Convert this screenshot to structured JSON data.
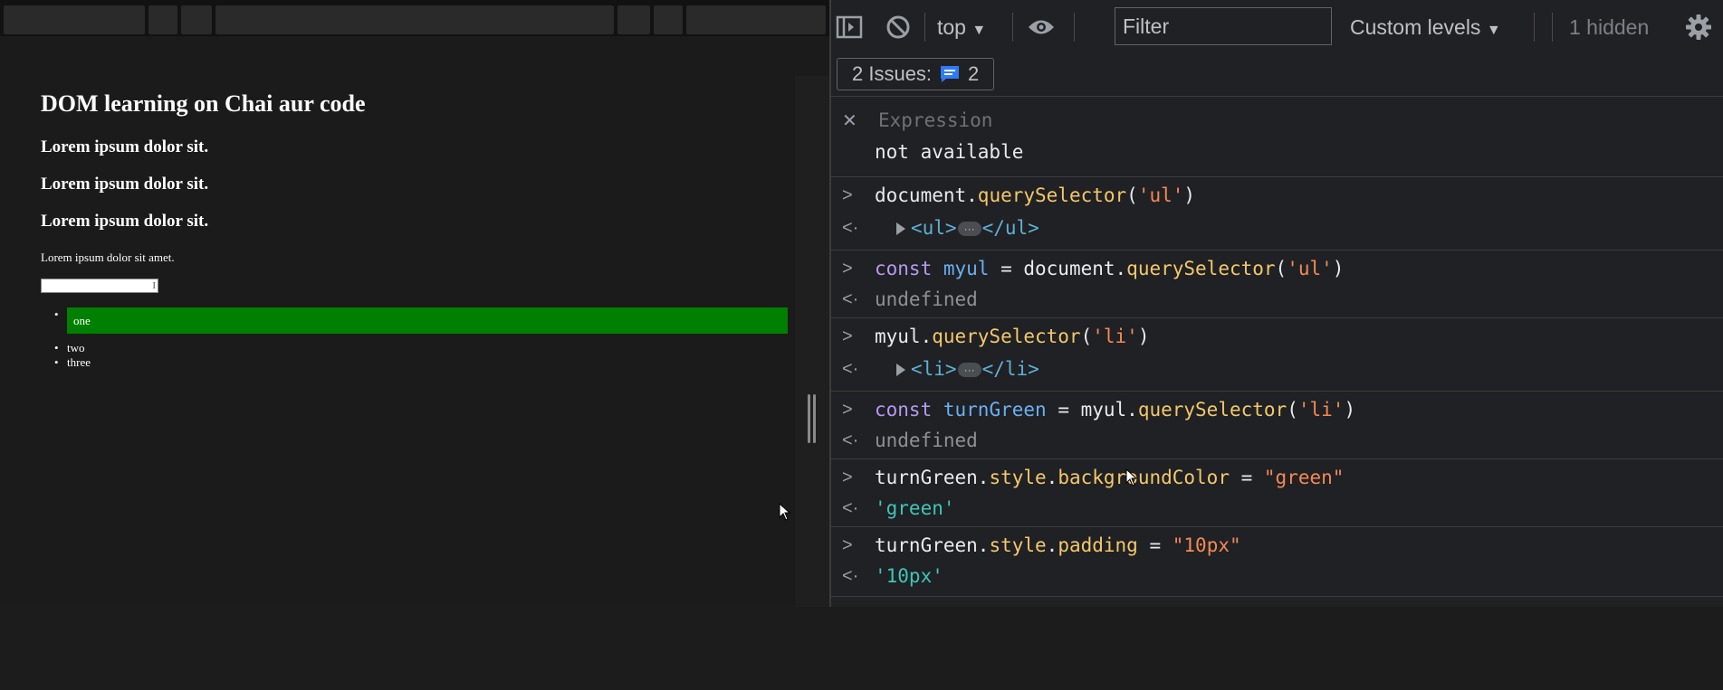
{
  "page": {
    "heading": "DOM learning on Chai aur code",
    "subheadings": [
      "Lorem ipsum dolor sit.",
      "Lorem ipsum dolor sit.",
      "Lorem ipsum dolor sit."
    ],
    "paragraph": "Lorem ipsum dolor sit amet.",
    "list_items": [
      "one",
      "two",
      "three"
    ],
    "highlight_color": "#008000"
  },
  "devtools": {
    "toolbar": {
      "context": "top",
      "filter_placeholder": "Filter",
      "levels": "Custom levels",
      "hidden": "1 hidden"
    },
    "issues": {
      "label": "2 Issues:",
      "count": "2"
    },
    "expression": {
      "label": "Expression",
      "value": "not available"
    },
    "console": [
      {
        "input": "document.querySelector('ul')",
        "output": "<ul> … </ul>"
      },
      {
        "input": "const myul = document.querySelector('ul')",
        "output": "undefined"
      },
      {
        "input": "myul.querySelector('li')",
        "output": "<li> … </li>"
      },
      {
        "input": "const turnGreen = myul.querySelector('li')",
        "output": "undefined"
      },
      {
        "input": "turnGreen.style.backgroundColor = \"green\"",
        "output": "'green'"
      },
      {
        "input": "turnGreen.style.padding = \"10px\"",
        "output": "'10px'"
      }
    ]
  }
}
